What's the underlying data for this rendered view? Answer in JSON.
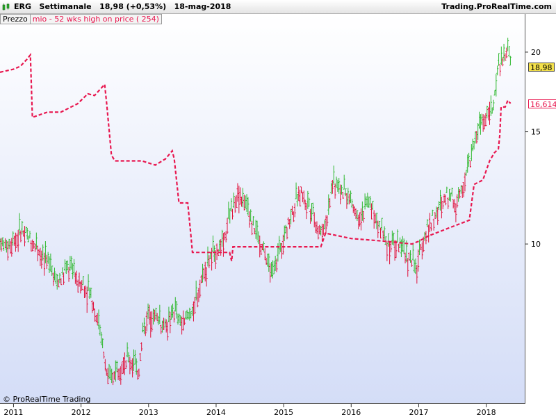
{
  "header": {
    "symbol": "ERG",
    "timeframe": "Settimanale",
    "last_price": "18,98 (+0,53%)",
    "date": "18-mag-2018",
    "provider": "Trading.ProRealTime.com"
  },
  "legend": {
    "price_label": "Prezzo",
    "indicator_label": "mio - 52 wks high on price ( 254)"
  },
  "footer": {
    "copyright": "© ProRealTime Trading"
  },
  "colors": {
    "up": "#2eb82e",
    "down": "#e0103a",
    "indicator": "#e8174f",
    "price_tag": "#f4e14a"
  },
  "chart_data": {
    "type": "bar",
    "subtype": "weekly OHLC bars with dashed indicator line",
    "y_scale": "log",
    "ylim": [
      5.7,
      22.0
    ],
    "y_ticks": [
      {
        "value": 10,
        "label": "10"
      },
      {
        "value": 15,
        "label": "15"
      },
      {
        "value": 20,
        "label": "20"
      }
    ],
    "x_ticks": [
      {
        "value": 2011.0,
        "label": "2011"
      },
      {
        "value": 2012.0,
        "label": "2012"
      },
      {
        "value": 2013.0,
        "label": "2013"
      },
      {
        "value": 2014.0,
        "label": "2014"
      },
      {
        "value": 2015.0,
        "label": "2015"
      },
      {
        "value": 2016.0,
        "label": "2016"
      },
      {
        "value": 2017.0,
        "label": "2017"
      },
      {
        "value": 2018.0,
        "label": "2018"
      }
    ],
    "xlim": [
      2010.8,
      2018.58
    ],
    "last_price_value": 18.98,
    "last_price_label": "18,98",
    "indicator_last_value": 16.614,
    "indicator_last_label": "16,614",
    "price_series": {
      "name": "Prezzo",
      "points": [
        [
          2010.8,
          10.0
        ],
        [
          2010.9,
          9.9
        ],
        [
          2011.0,
          10.2
        ],
        [
          2011.12,
          10.5
        ],
        [
          2011.25,
          10.1
        ],
        [
          2011.35,
          10.0
        ],
        [
          2011.45,
          9.5
        ],
        [
          2011.55,
          9.2
        ],
        [
          2011.65,
          8.7
        ],
        [
          2011.75,
          9.0
        ],
        [
          2011.85,
          9.2
        ],
        [
          2011.95,
          8.8
        ],
        [
          2012.05,
          8.6
        ],
        [
          2012.15,
          8.3
        ],
        [
          2012.25,
          7.6
        ],
        [
          2012.32,
          6.9
        ],
        [
          2012.38,
          6.3
        ],
        [
          2012.42,
          6.1
        ],
        [
          2012.5,
          6.3
        ],
        [
          2012.6,
          6.5
        ],
        [
          2012.7,
          6.6
        ],
        [
          2012.78,
          6.5
        ],
        [
          2012.85,
          6.3
        ],
        [
          2012.92,
          7.3
        ],
        [
          2013.0,
          7.8
        ],
        [
          2013.1,
          7.7
        ],
        [
          2013.2,
          7.5
        ],
        [
          2013.3,
          7.5
        ],
        [
          2013.38,
          7.9
        ],
        [
          2013.45,
          7.5
        ],
        [
          2013.55,
          7.6
        ],
        [
          2013.65,
          7.8
        ],
        [
          2013.72,
          8.3
        ],
        [
          2013.8,
          9.0
        ],
        [
          2013.9,
          9.5
        ],
        [
          2014.0,
          9.8
        ],
        [
          2014.1,
          10.0
        ],
        [
          2014.18,
          10.8
        ],
        [
          2014.25,
          11.5
        ],
        [
          2014.32,
          12.1
        ],
        [
          2014.4,
          11.7
        ],
        [
          2014.47,
          11.3
        ],
        [
          2014.55,
          10.8
        ],
        [
          2014.62,
          10.2
        ],
        [
          2014.7,
          9.8
        ],
        [
          2014.78,
          9.2
        ],
        [
          2014.85,
          9.0
        ],
        [
          2014.92,
          9.6
        ],
        [
          2015.0,
          10.3
        ],
        [
          2015.1,
          11.0
        ],
        [
          2015.18,
          11.6
        ],
        [
          2015.27,
          12.2
        ],
        [
          2015.33,
          11.7
        ],
        [
          2015.42,
          11.3
        ],
        [
          2015.5,
          10.7
        ],
        [
          2015.58,
          10.4
        ],
        [
          2015.66,
          11.3
        ],
        [
          2015.72,
          12.5
        ],
        [
          2015.8,
          12.4
        ],
        [
          2015.9,
          12.0
        ],
        [
          2016.0,
          11.7
        ],
        [
          2016.1,
          11.1
        ],
        [
          2016.2,
          11.3
        ],
        [
          2016.28,
          11.6
        ],
        [
          2016.38,
          10.8
        ],
        [
          2016.45,
          10.5
        ],
        [
          2016.53,
          10.0
        ],
        [
          2016.62,
          10.0
        ],
        [
          2016.7,
          10.0
        ],
        [
          2016.8,
          9.6
        ],
        [
          2016.9,
          9.5
        ],
        [
          2016.96,
          9.0
        ],
        [
          2017.02,
          9.8
        ],
        [
          2017.1,
          10.4
        ],
        [
          2017.2,
          11.0
        ],
        [
          2017.3,
          11.3
        ],
        [
          2017.4,
          11.9
        ],
        [
          2017.48,
          11.9
        ],
        [
          2017.55,
          11.6
        ],
        [
          2017.65,
          12.5
        ],
        [
          2017.75,
          13.3
        ],
        [
          2017.85,
          14.8
        ],
        [
          2017.95,
          15.6
        ],
        [
          2018.02,
          16.0
        ],
        [
          2018.1,
          16.2
        ],
        [
          2018.14,
          17.2
        ],
        [
          2018.17,
          19.0
        ],
        [
          2018.22,
          19.5
        ],
        [
          2018.27,
          19.4
        ],
        [
          2018.32,
          20.3
        ],
        [
          2018.36,
          18.98
        ]
      ]
    },
    "indicator_series": {
      "name": "mio - 52 wks high on price ( 254)",
      "style": "dashed",
      "points": [
        [
          2010.8,
          18.6
        ],
        [
          2011.0,
          18.8
        ],
        [
          2011.1,
          19.0
        ],
        [
          2011.2,
          19.5
        ],
        [
          2011.25,
          19.8
        ],
        [
          2011.28,
          15.8
        ],
        [
          2011.5,
          16.1
        ],
        [
          2011.7,
          16.1
        ],
        [
          2011.95,
          16.6
        ],
        [
          2012.1,
          17.2
        ],
        [
          2012.2,
          17.1
        ],
        [
          2012.35,
          17.8
        ],
        [
          2012.38,
          16.6
        ],
        [
          2012.45,
          13.8
        ],
        [
          2012.5,
          13.5
        ],
        [
          2012.9,
          13.5
        ],
        [
          2013.1,
          13.3
        ],
        [
          2013.25,
          13.6
        ],
        [
          2013.35,
          14.0
        ],
        [
          2013.38,
          13.6
        ],
        [
          2013.45,
          11.6
        ],
        [
          2013.58,
          11.6
        ],
        [
          2013.62,
          10.5
        ],
        [
          2013.65,
          9.7
        ],
        [
          2014.05,
          9.7
        ],
        [
          2014.2,
          9.7
        ],
        [
          2014.23,
          9.4
        ],
        [
          2014.25,
          9.9
        ],
        [
          2014.35,
          9.9
        ],
        [
          2014.55,
          9.9
        ],
        [
          2015.0,
          9.9
        ],
        [
          2015.4,
          9.9
        ],
        [
          2015.55,
          9.9
        ],
        [
          2015.62,
          10.4
        ],
        [
          2016.0,
          10.2
        ],
        [
          2016.5,
          10.1
        ],
        [
          2016.9,
          10.0
        ],
        [
          2017.0,
          10.1
        ],
        [
          2017.15,
          10.3
        ],
        [
          2017.45,
          10.6
        ],
        [
          2017.75,
          10.9
        ],
        [
          2017.82,
          12.4
        ],
        [
          2017.95,
          12.6
        ],
        [
          2018.05,
          13.5
        ],
        [
          2018.12,
          13.9
        ],
        [
          2018.18,
          14.1
        ],
        [
          2018.2,
          14.8
        ],
        [
          2018.22,
          16.4
        ],
        [
          2018.28,
          16.4
        ],
        [
          2018.32,
          16.8
        ],
        [
          2018.36,
          16.614
        ]
      ]
    }
  }
}
